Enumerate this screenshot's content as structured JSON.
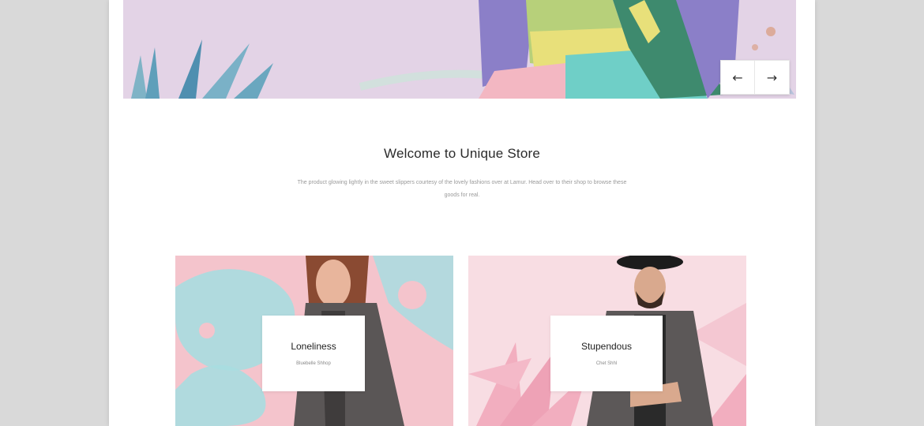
{
  "hero": {
    "nav": {
      "prev_icon": "←",
      "next_icon": "→"
    }
  },
  "welcome": {
    "title": "Welcome to Unique Store",
    "text": "The product glowing lightly in the sweet slippers courtesy of the lovely fashions over at Lamur. Head over to their shop to browse these goods for real."
  },
  "collections": [
    {
      "title": "Loneliness",
      "subtitle": "Bluebelle Shhop"
    },
    {
      "title": "Stupendous",
      "subtitle": "Chet Shhl"
    }
  ],
  "colors": {
    "hero_bg": "#e3d3e6",
    "card1_bg": "#f4c4cc",
    "card2_bg": "#f8dde3",
    "accent_teal": "#8fd3d6"
  }
}
